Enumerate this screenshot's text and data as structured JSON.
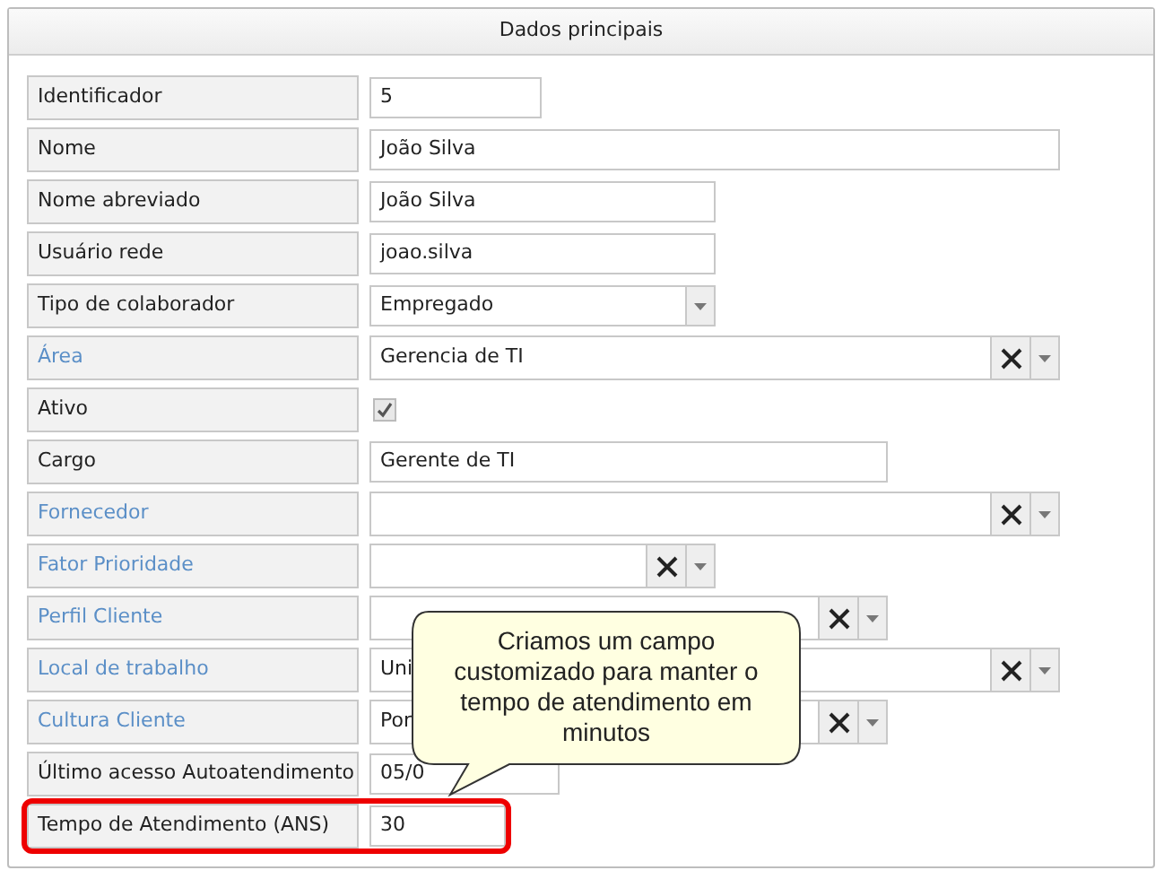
{
  "panel": {
    "title": "Dados principais"
  },
  "fields": [
    {
      "label": "Identificador",
      "linked": false,
      "kind": "text",
      "value": "5",
      "highlighted": false
    },
    {
      "label": "Nome",
      "linked": false,
      "kind": "text",
      "value": "João Silva",
      "highlighted": false
    },
    {
      "label": "Nome abreviado",
      "linked": false,
      "kind": "text",
      "value": "João Silva",
      "highlighted": false
    },
    {
      "label": "Usuário rede",
      "linked": false,
      "kind": "text",
      "value": "joao.silva",
      "highlighted": false
    },
    {
      "label": "Tipo de colaborador",
      "linked": false,
      "kind": "combo",
      "value": "Empregado",
      "highlighted": false
    },
    {
      "label": "Área",
      "linked": true,
      "kind": "lookup",
      "value": "Gerencia de TI",
      "highlighted": false
    },
    {
      "label": "Ativo",
      "linked": false,
      "kind": "checkbox",
      "checked": true,
      "highlighted": false
    },
    {
      "label": "Cargo",
      "linked": false,
      "kind": "text",
      "value": "Gerente de TI",
      "highlighted": false
    },
    {
      "label": "Fornecedor",
      "linked": true,
      "kind": "lookup",
      "highlighted": false
    },
    {
      "label": "Fator Prioridade",
      "linked": true,
      "kind": "lookup",
      "highlighted": false
    },
    {
      "label": "Perfil Cliente",
      "linked": true,
      "kind": "lookup",
      "highlighted": false
    },
    {
      "label": "Local de trabalho",
      "linked": true,
      "kind": "lookup",
      "value": "Uni",
      "highlighted": false
    },
    {
      "label": "Cultura Cliente",
      "linked": true,
      "kind": "lookup",
      "value": "Por",
      "highlighted": false
    },
    {
      "label": "Último acesso Autoatendimento",
      "linked": false,
      "kind": "text",
      "value": "05/0",
      "highlighted": false
    },
    {
      "label": "Tempo de Atendimento (ANS)",
      "linked": false,
      "kind": "text",
      "value": "30",
      "highlighted": true
    }
  ],
  "callout": {
    "text": "Criamos um campo customizado para manter o tempo de atendimento em minutos"
  }
}
